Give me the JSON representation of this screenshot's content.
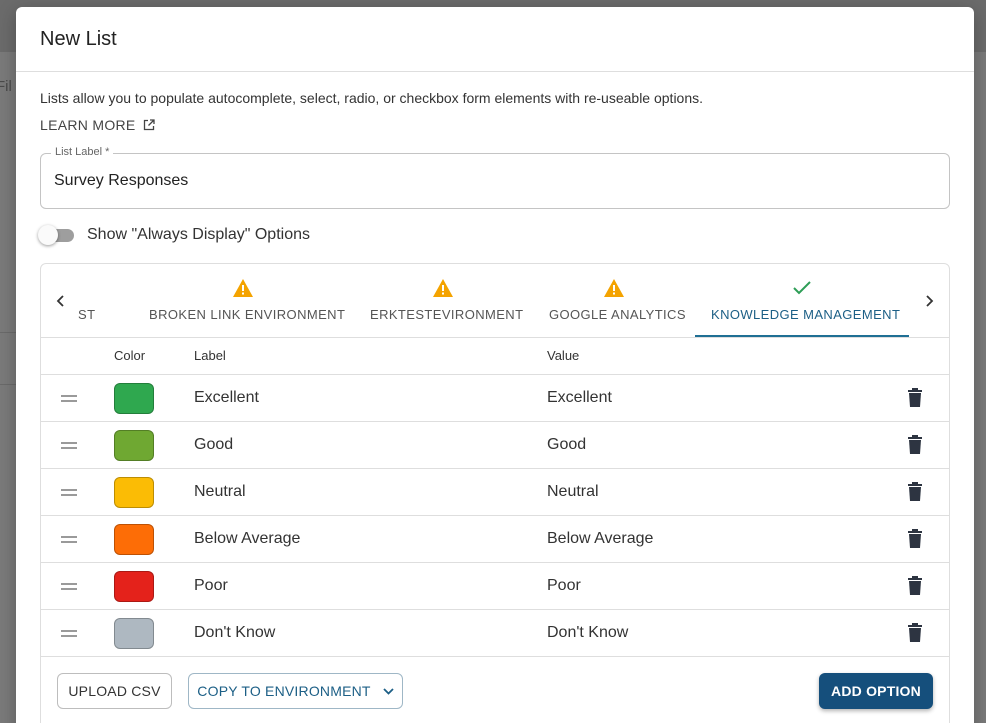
{
  "background": {
    "filter_fragment": "Fil"
  },
  "dialog": {
    "title": "New List",
    "description": "Lists allow you to populate autocomplete, select, radio, or checkbox form elements with re-useable options.",
    "learn_more": "LEARN MORE",
    "list_label_field": {
      "label": "List Label *",
      "value": "Survey Responses"
    },
    "toggle": {
      "label": "Show \"Always Display\" Options",
      "checked": false
    }
  },
  "tabs": [
    {
      "label": "ST",
      "status": "none",
      "active": false
    },
    {
      "label": "BROKEN LINK ENVIRONMENT",
      "status": "warning",
      "active": false
    },
    {
      "label": "ERKTESTEVIRONMENT",
      "status": "warning",
      "active": false
    },
    {
      "label": "GOOGLE ANALYTICS",
      "status": "warning",
      "active": false
    },
    {
      "label": "KNOWLEDGE MANAGEMENT",
      "status": "check",
      "active": true
    }
  ],
  "table": {
    "headers": {
      "color": "Color",
      "label": "Label",
      "value": "Value"
    },
    "rows": [
      {
        "color": "#2fa84f",
        "label": "Excellent",
        "value": "Excellent"
      },
      {
        "color": "#6fa832",
        "label": "Good",
        "value": "Good"
      },
      {
        "color": "#fbbc05",
        "label": "Neutral",
        "value": "Neutral"
      },
      {
        "color": "#fd6d06",
        "label": "Below Average",
        "value": "Below Average"
      },
      {
        "color": "#e4221b",
        "label": "Poor",
        "value": "Poor"
      },
      {
        "color": "#aeb8c1",
        "label": "Don't Know",
        "value": "Don't Know"
      }
    ]
  },
  "buttons": {
    "upload_csv": "UPLOAD CSV",
    "copy_to_environment": "COPY TO ENVIRONMENT",
    "add_option": "ADD OPTION"
  },
  "colors": {
    "accent": "#1c5f86",
    "primary_button": "#154f7c",
    "warning": "#f4a300",
    "success": "#2e9e57"
  }
}
